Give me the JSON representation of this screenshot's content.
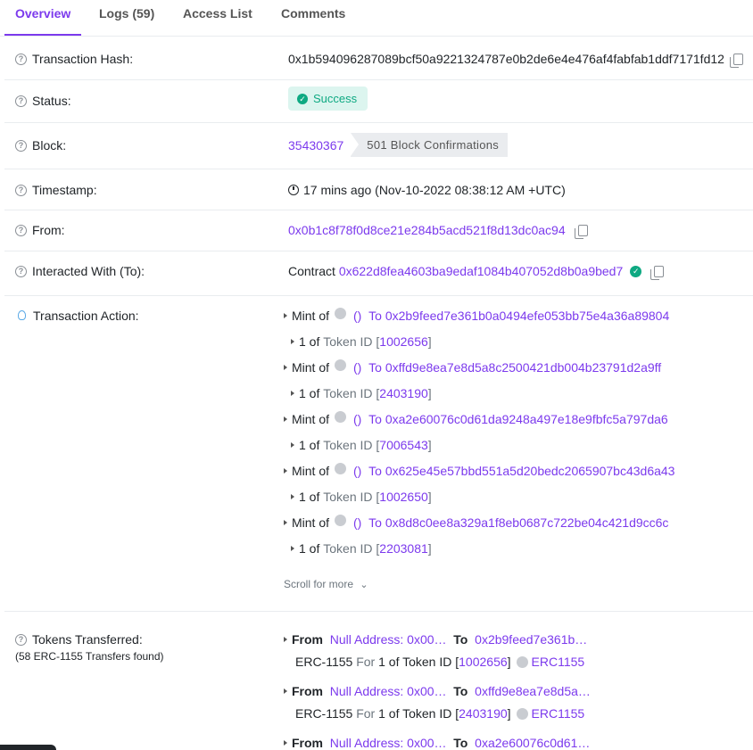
{
  "tabs": [
    {
      "label": "Overview"
    },
    {
      "label": "Logs (59)"
    },
    {
      "label": "Access List"
    },
    {
      "label": "Comments"
    }
  ],
  "tx": {
    "hash_label": "Transaction Hash:",
    "hash": "0x1b594096287089bcf50a9221324787e0b2de6e4e476af4fabfab1ddf7171fd12",
    "status_label": "Status:",
    "status": "Success",
    "block_label": "Block:",
    "block": "35430367",
    "confirmations": "501 Block Confirmations",
    "timestamp_label": "Timestamp:",
    "timestamp": "17 mins ago (Nov-10-2022 08:38:12 AM +UTC)",
    "from_label": "From:",
    "from": "0x0b1c8f78f0d8ce21e284b5acd521f8d13dc0ac94",
    "to_label": "Interacted With (To):",
    "to_prefix": "Contract",
    "to": "0x622d8fea4603ba9edaf1084b407052d8b0a9bed7",
    "action_label": "Transaction Action:",
    "tokens_label": "Tokens Transferred:",
    "tokens_sub": "(58 ERC-1155 Transfers found)"
  },
  "actions": {
    "mint_text": "Mint of",
    "paren": "()",
    "to_text": "To",
    "one_of": "1 of",
    "token_id_text": "Token ID",
    "scroll_more": "Scroll for more",
    "items": [
      {
        "to": "0x2b9feed7e361b0a0494efe053bb75e4a36a89804",
        "token_id": "1002656"
      },
      {
        "to": "0xffd9e8ea7e8d5a8c2500421db004b23791d2a9ff",
        "token_id": "2403190"
      },
      {
        "to": "0xa2e60076c0d61da9248a497e18e9fbfc5a797da6",
        "token_id": "7006543"
      },
      {
        "to": "0x625e45e57bbd551a5d20bedc2065907bc43d6a43",
        "token_id": "1002650"
      },
      {
        "to": "0x8d8c0ee8a329a1f8eb0687c722be04c421d9cc6c",
        "token_id": "2203081"
      }
    ]
  },
  "transfers": {
    "from_text": "From",
    "to_text": "To",
    "standard": "ERC-1155",
    "for_text": "For",
    "one_of": "1 of Token ID",
    "token_name": "ERC1155",
    "items": [
      {
        "from": "Null Address: 0x00…",
        "to": "0x2b9feed7e361b…",
        "token_id": "1002656"
      },
      {
        "from": "Null Address: 0x00…",
        "to": "0xffd9e8ea7e8d5a…",
        "token_id": "2403190"
      },
      {
        "from": "Null Address: 0x00…",
        "to": "0xa2e60076c0d61…"
      }
    ]
  },
  "colors": {
    "accent": "#7c3aed",
    "success": "#0ea982"
  },
  "icons": [
    "question-icon",
    "copy-icon",
    "check-circle-icon",
    "clock-icon",
    "verified-icon",
    "lightbulb-icon",
    "caret-right-icon",
    "token-icon",
    "double-chevron-down-icon"
  ]
}
